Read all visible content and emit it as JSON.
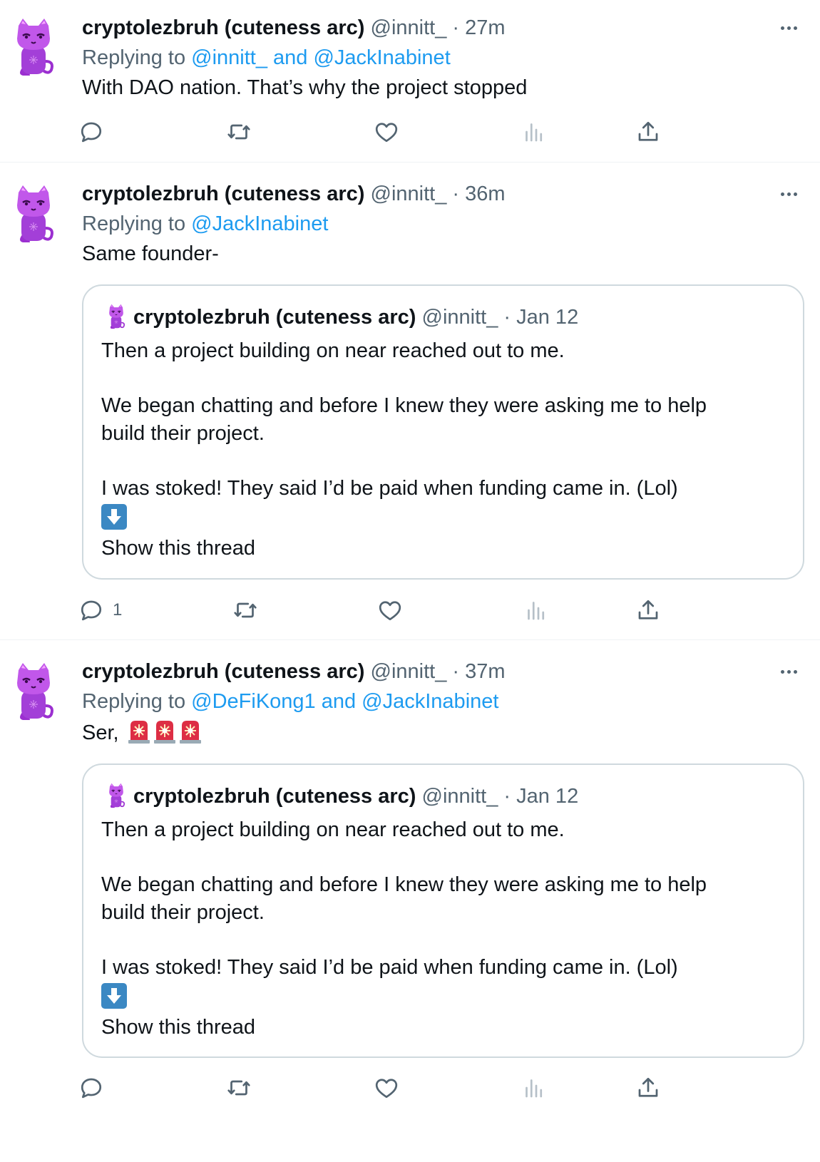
{
  "tweets": [
    {
      "name": "cryptolezbruh (cuteness arc)",
      "handle": "@innitt_",
      "time": "· 27m",
      "replying_prefix": "Replying to",
      "replying_to": "@innitt_ and @JackInabinet",
      "text": "With DAO nation. That’s why the project stopped",
      "replies": ""
    },
    {
      "name": "cryptolezbruh (cuteness arc)",
      "handle": "@innitt_",
      "time": "· 36m",
      "replying_prefix": "Replying to",
      "replying_to": "@JackInabinet",
      "text": "Same founder-",
      "replies": "1",
      "quote": {
        "name": "cryptolezbruh (cuteness arc)",
        "handle": "@innitt_",
        "time": "· Jan 12",
        "line1": "Then a project building on near reached out to me.",
        "line2": "We began chatting and before I knew they were asking me to help",
        "line3": "build their project.",
        "line4": "I was stoked! They said I’d be paid when funding came in. (Lol)",
        "show_thread": "Show this thread"
      }
    },
    {
      "name": "cryptolezbruh (cuteness arc)",
      "handle": "@innitt_",
      "time": "· 37m",
      "replying_prefix": "Replying to",
      "replying_to": "@DeFiKong1 and @JackInabinet",
      "text": "Ser,",
      "replies": "",
      "quote": {
        "name": "cryptolezbruh (cuteness arc)",
        "handle": "@innitt_",
        "time": "· Jan 12",
        "line1": "Then a project building on near reached out to me.",
        "line2": "We began chatting and before I knew they were asking me to help",
        "line3": "build their project.",
        "line4": "I was stoked! They said I’d be paid when funding came in. (Lol)",
        "show_thread": "Show this thread"
      }
    }
  ],
  "icons": {
    "avatar": "purple-cat-avatar-icon",
    "reply": "reply-icon",
    "retweet": "retweet-icon",
    "like": "heart-icon",
    "views": "views-chart-icon",
    "share": "share-icon",
    "more": "more-dots-icon",
    "down_arrow": "down-arrow-emoji",
    "siren": "police-light-emoji"
  },
  "colors": {
    "link": "#1d9bf0",
    "secondary_text": "#536471",
    "border": "#cfd9de",
    "avatar_purple": "#b94ae0",
    "emoji_blue": "#3b88c3",
    "siren_red": "#dd2e44"
  }
}
